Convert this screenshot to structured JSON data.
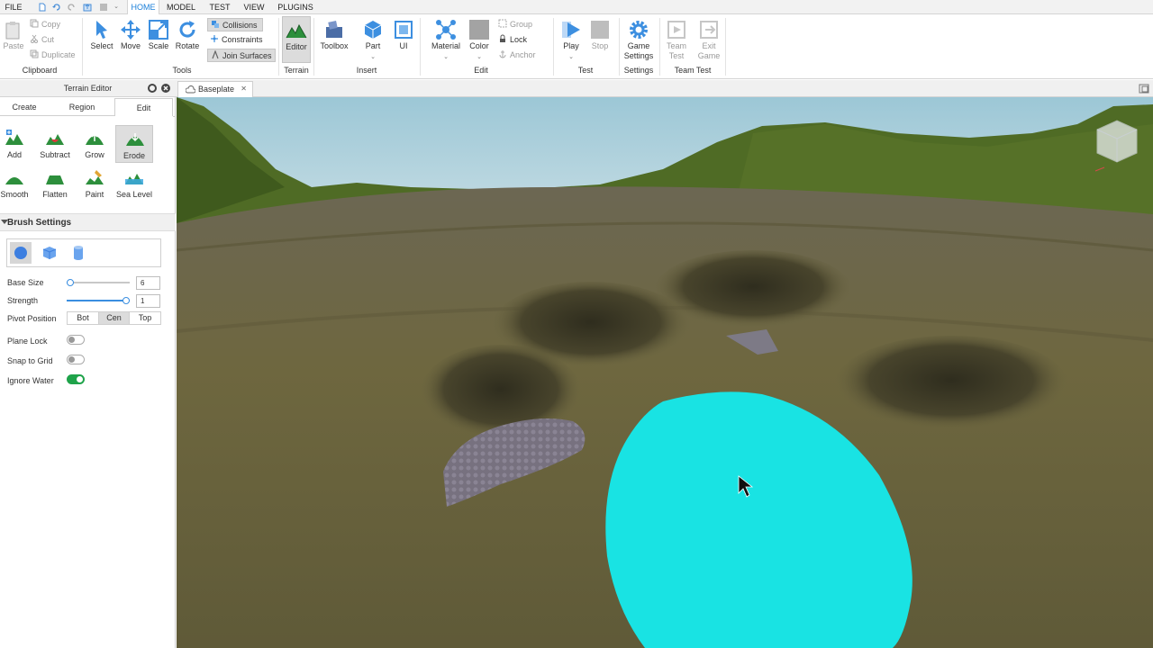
{
  "menu": {
    "file": "FILE",
    "tabs": [
      "HOME",
      "MODEL",
      "TEST",
      "VIEW",
      "PLUGINS"
    ],
    "active_tab": "HOME"
  },
  "ribbon": {
    "clipboard": {
      "paste": "Paste",
      "copy": "Copy",
      "cut": "Cut",
      "duplicate": "Duplicate",
      "group": "Clipboard"
    },
    "tools": {
      "select": "Select",
      "move": "Move",
      "scale": "Scale",
      "rotate": "Rotate",
      "collisions": "Collisions",
      "constraints": "Constraints",
      "join_surfaces": "Join Surfaces",
      "group": "Tools"
    },
    "terrain": {
      "editor": "Editor",
      "group": "Terrain"
    },
    "insert": {
      "toolbox": "Toolbox",
      "part": "Part",
      "ui": "UI",
      "group": "Insert"
    },
    "edit": {
      "material": "Material",
      "color": "Color",
      "group_btn": "Group",
      "lock": "Lock",
      "anchor": "Anchor",
      "group": "Edit"
    },
    "test": {
      "play": "Play",
      "stop": "Stop",
      "group": "Test"
    },
    "settings": {
      "game_settings_1": "Game",
      "game_settings_2": "Settings",
      "group": "Settings"
    },
    "team_test": {
      "team_test_1": "Team",
      "team_test_2": "Test",
      "exit_game_1": "Exit",
      "exit_game_2": "Game",
      "group": "Team Test"
    },
    "dropdown_glyph": "⌄"
  },
  "panel": {
    "title": "Terrain Editor",
    "tabs": [
      "Create",
      "Region",
      "Edit"
    ],
    "active_tab": "Edit",
    "tools": [
      "Add",
      "Subtract",
      "Grow",
      "Erode",
      "Smooth",
      "Flatten",
      "Paint",
      "Sea Level"
    ],
    "selected_tool": "Erode",
    "brush_settings": {
      "header": "Brush Settings",
      "shapes": [
        "sphere-shape",
        "cube-shape",
        "cylinder-shape"
      ],
      "selected_shape": "sphere-shape",
      "base_size_label": "Base Size",
      "base_size_value": "6",
      "base_size_fraction": 0.05,
      "strength_label": "Strength",
      "strength_value": "1",
      "strength_fraction": 1.0,
      "pivot_label": "Pivot Position",
      "pivot_options": [
        "Bot",
        "Cen",
        "Top"
      ],
      "pivot_selected": "Cen",
      "plane_lock_label": "Plane Lock",
      "plane_lock": false,
      "snap_to_grid_label": "Snap to Grid",
      "snap_to_grid": false,
      "ignore_water_label": "Ignore Water",
      "ignore_water": true
    }
  },
  "document": {
    "tab_label": "Baseplate",
    "close_glyph": "✕"
  },
  "colors": {
    "accent": "#1a7fd9",
    "brush": "#19e3e3",
    "toggle_on": "#1fa34a",
    "terrain": "#6b6540",
    "sky": "#a9cfdc",
    "hills": "#4f6b25"
  }
}
